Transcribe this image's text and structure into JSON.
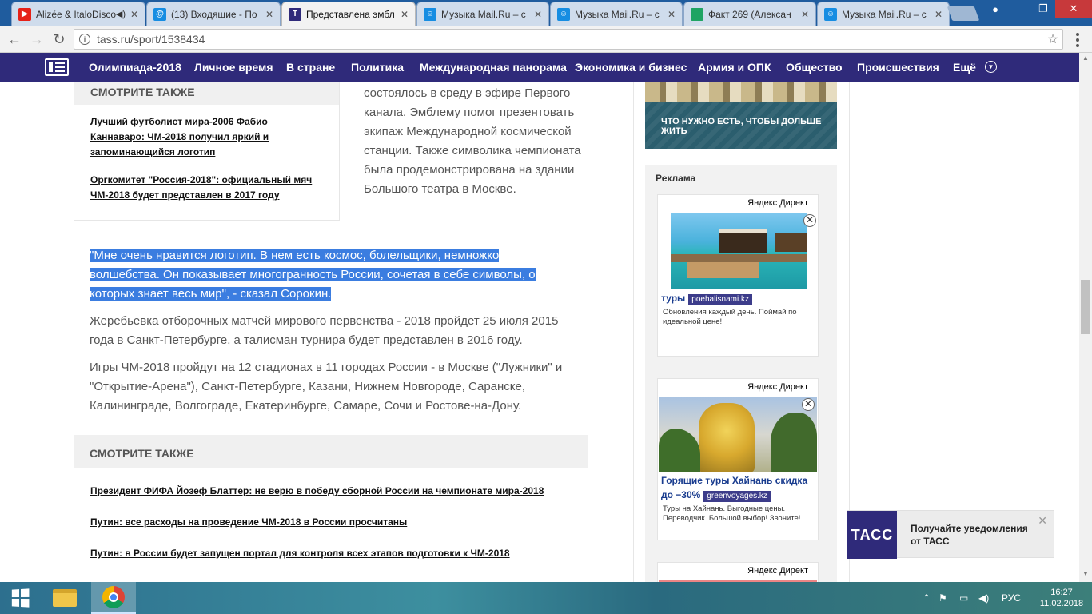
{
  "browser": {
    "tabs": [
      {
        "title": "Alizée & ItaloDisco",
        "icon": "youtube-icon",
        "color": "#e62117"
      },
      {
        "title": "(13) Входящие - По",
        "icon": "mail-at-icon",
        "color": "#168de2"
      },
      {
        "title": "Представлена эмбл",
        "icon": "tass-t-icon",
        "color": "#2f2a7a"
      },
      {
        "title": "Музыка Mail.Ru – с",
        "icon": "mailru-music-icon",
        "color": "#168de2"
      },
      {
        "title": "Музыка Mail.Ru – с",
        "icon": "mailru-music-icon",
        "color": "#168de2"
      },
      {
        "title": "Факт 269 (Алексан",
        "icon": "sheet-icon",
        "color": "#1fa463"
      },
      {
        "title": "Музыка Mail.Ru – с",
        "icon": "mailru-music-icon",
        "color": "#168de2"
      }
    ],
    "active_tab_index": 2,
    "url": "tass.ru/sport/1538434"
  },
  "site_nav": {
    "items": [
      "Олимпиада-2018",
      "Личное время",
      "В стране",
      "Политика",
      "Международная панорама",
      "Экономика и бизнес",
      "Армия и ОПК",
      "Общество",
      "Происшествия",
      "Ещё"
    ],
    "bg_color": "#2f2a7a"
  },
  "article": {
    "see_also_small": {
      "heading": "СМОТРИТЕ ТАКЖЕ",
      "links": [
        "Лучший футболист мира-2006 Фабио Каннаваро: ЧМ-2018 получил яркий и запоминающийся логотип",
        "Оргкомитет \"Россия-2018\": официальный мяч ЧМ-2018 будет представлен в 2017 году"
      ]
    },
    "narrow_paragraph": "состоялось в среду в эфире Первого канала. Эмблему помог презентовать экипаж Международной космической станции. Также символика чемпионата была продемонстрирована на здании Большого театра в Москве.",
    "quote": "\"Мне очень нравится логотип. В нем есть космос, болельщики, немножко волшебства. Он показывает многогранность России, сочетая в себе символы, о которых знает весь мир\", - сказал Сорокин.",
    "paragraph_1": "Жеребьевка отборочных матчей мирового первенства - 2018 пройдет 25 июля 2015 года в Санкт-Петербурге, а талисман турнира будет представлен в 2016 году.",
    "paragraph_2": "Игры ЧМ-2018 пройдут на 12 стадионах в 11 городах России - в Москве (\"Лужники\" и \"Открытие-Арена\"), Санкт-Петербурге, Казани, Нижнем Новгороде, Саранске, Калининграде, Волгограде, Екатеринбурге, Самаре, Сочи и Ростове-на-Дону.",
    "see_also_big": {
      "heading": "СМОТРИТЕ ТАКЖЕ",
      "links": [
        "Президент ФИФА Йозеф Блаттер: не верю в победу сборной России на чемпионате мира-2018",
        "Путин: все расходы на проведение ЧМ-2018 в России просчитаны",
        "Путин: в России будет запущен портал для контроля всех этапов подготовки к ЧМ-2018"
      ]
    }
  },
  "sidebar": {
    "promo_text": "ЧТО НУЖНО ЕСТЬ, ЧТОБЫ ДОЛЬШЕ ЖИТЬ",
    "ad_label": "Реклама",
    "ads": [
      {
        "provider": "Яндекс Директ",
        "title": "туры",
        "domain": "poehalisnami.kz",
        "text": "Обновления каждый день. Поймай по идеальной цене!"
      },
      {
        "provider": "Яндекс Директ",
        "title": "Горящие туры Хайнань скидка до −30%",
        "domain": "greenvoyages.kz",
        "text": "Туры на Хайнань. Выгодные цены. Переводчик. Большой выбор! Звоните!"
      },
      {
        "provider": "Яндекс Директ"
      }
    ]
  },
  "notification": {
    "logo": "ТАСС",
    "text": "Получайте уведомления от ТАСС"
  },
  "taskbar": {
    "language": "РУС",
    "time": "16:27",
    "date": "11.02.2018"
  }
}
